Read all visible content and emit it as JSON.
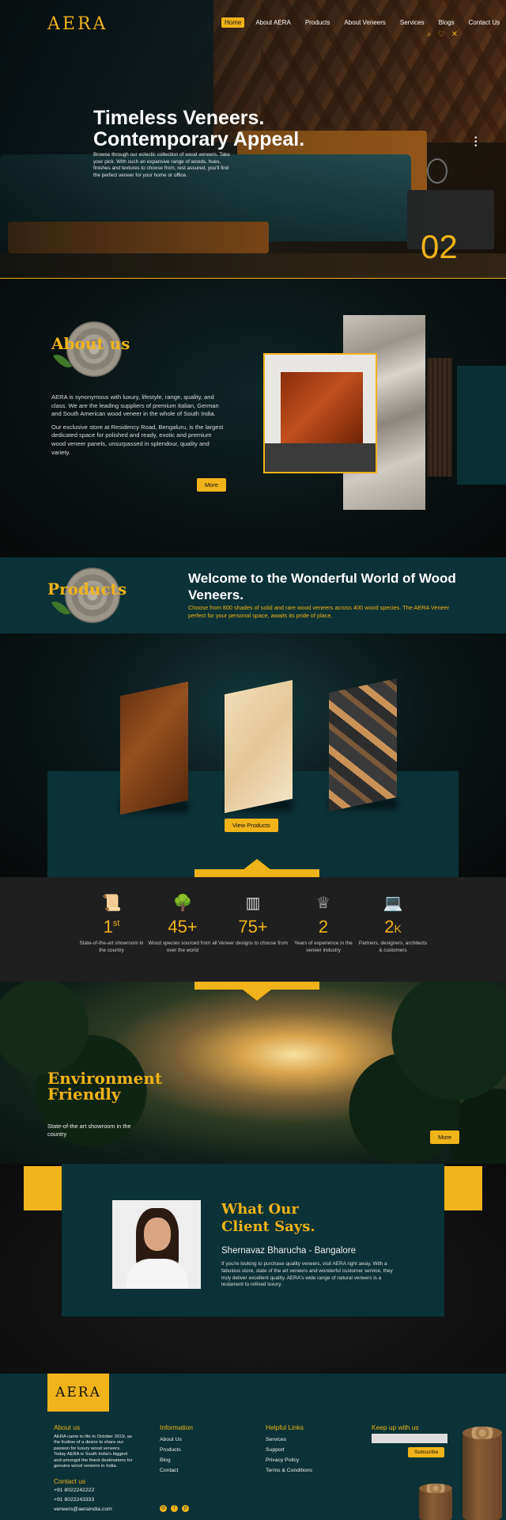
{
  "brand": {
    "logo": "AERA",
    "accent": "#f0b31a",
    "teal": "#0b3236"
  },
  "nav": {
    "items": [
      "Home",
      "About AERA",
      "Products",
      "About Veneers",
      "Services",
      "Blogs",
      "Contact Us"
    ],
    "active": "Home",
    "icons": [
      "search-icon",
      "heart-icon",
      "close-icon"
    ]
  },
  "hero": {
    "title_line1": "Timeless Veneers.",
    "title_line2": "Contemporary Appeal.",
    "description": "Browse through our eclectic collection of wood veneers. Take your pick. With such an expansive range of woods, hues, finishes and textures to choose from, rest assured, you'll find the perfect veneer for your home or office.",
    "slide_number": "02"
  },
  "about": {
    "heading": "About us",
    "p1": "AERA is synonymous with luxury, lifestyle, range, quality, and class. We are the leading suppliers of premium Italian, German and South American wood veneer in the whole of South India.",
    "p2": "Our exclusive store at Residency Road, Bengaluru, is the largest dedicated space for polished and ready, exotic and premium wood veneer panels, unsurpassed in splendour, quality and variety.",
    "more": "More"
  },
  "products": {
    "heading": "Products",
    "title": "Welcome to the Wonderful World of Wood Veneers.",
    "subtitle": "Choose from 800 shades of solid and rare wood veneers across 400 wood species. The AERA Veneer perfect for your personal space, awaits its pride of place.",
    "cta": "View Products"
  },
  "stats": [
    {
      "icon": "certificate-icon",
      "number": "1",
      "suffix": "st",
      "label": "State-of-the-art showroom in the country"
    },
    {
      "icon": "trees-icon",
      "number": "45+",
      "suffix": "",
      "label": "Wood species sourced from all over the world"
    },
    {
      "icon": "panels-icon",
      "number": "75+",
      "suffix": "",
      "label": "Veneer designs to choose from"
    },
    {
      "icon": "award-icon",
      "number": "2",
      "suffix": "",
      "label": "Years of experience in the veneer industry"
    },
    {
      "icon": "partners-icon",
      "number": "2",
      "suffix": "K",
      "label": "Partners, designers, architects & customers"
    }
  ],
  "environment": {
    "heading_line1": "Environment",
    "heading_line2": "Friendly",
    "text": "State-of-the art showroom in the country",
    "more": "More"
  },
  "testimonial": {
    "heading_line1": "What Our",
    "heading_line2": "Client Says.",
    "name": "Shernavaz Bharucha - Bangalore",
    "quote": "If you're looking to purchase quality veneers, visit AERA right away. With a fabulous store, state of the art veneers and wonderful customer service, they truly deliver excellent quality. AERA's wide range of natural veneers is a testament to refined luxury."
  },
  "footer": {
    "logo": "AERA",
    "about_heading": "About us",
    "about_text": "AERA came to life in October 2019, as the fruition of a desire to share our passion for luxury wood veneers. Today AERA is South India's biggest and amongst the finest destinations for genuine wood veneers in India.",
    "contact_heading": "Contact us",
    "phone1": "+91 8022242222",
    "phone2": "+91 8022243333",
    "email": "veneers@aeraindia.com",
    "info_heading": "Information",
    "info_links": [
      "About Us",
      "Products",
      "Blog",
      "Contact"
    ],
    "helpful_heading": "Helpful Links",
    "helpful_links": [
      "Services",
      "Support",
      "Privacy Policy",
      "Terms & Conditions"
    ],
    "keep_heading": "Keep up with us",
    "subscribe": "Subscribe",
    "socials": [
      "instagram-icon",
      "facebook-icon",
      "pinterest-icon"
    ]
  }
}
